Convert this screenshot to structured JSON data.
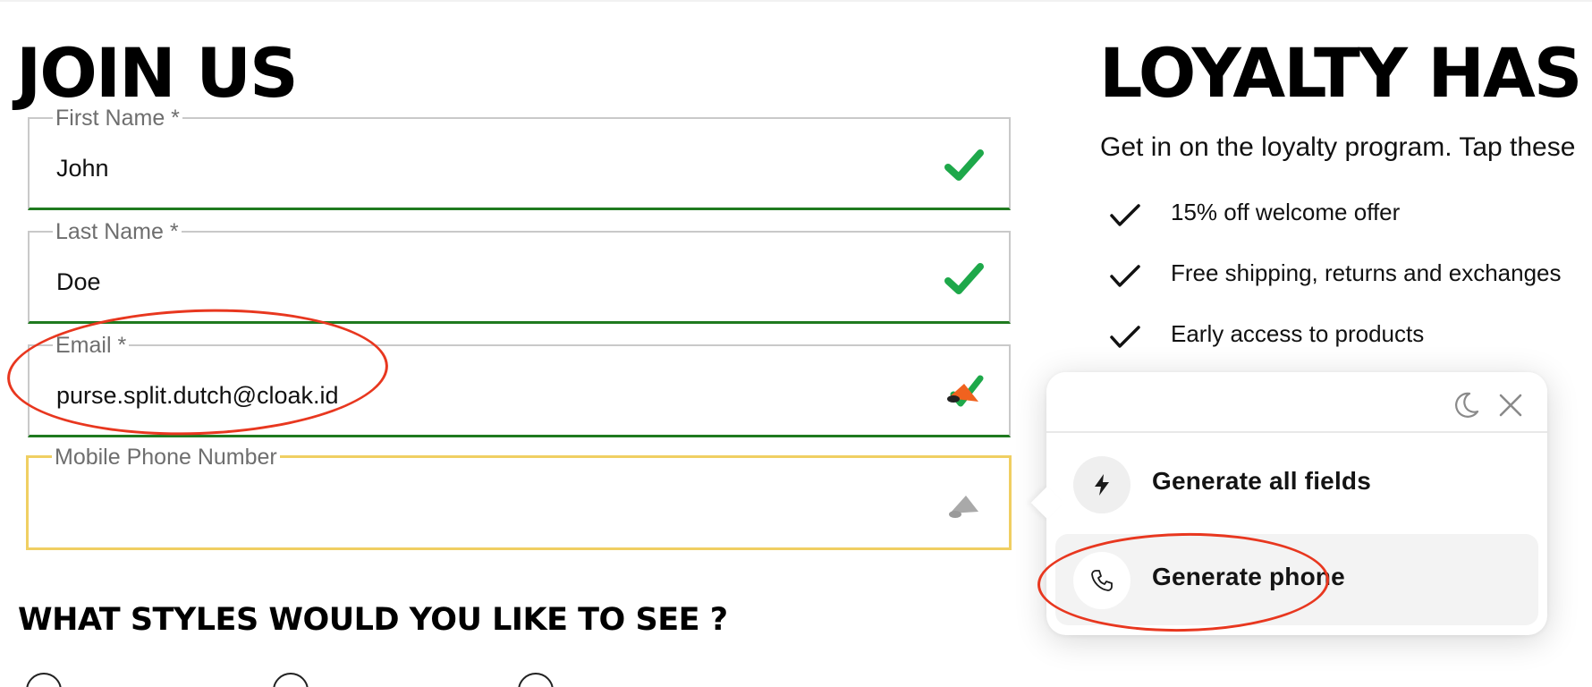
{
  "form": {
    "title": "JOIN US",
    "fields": [
      {
        "label": "First Name *",
        "value": "John",
        "status": "valid"
      },
      {
        "label": "Last Name *",
        "value": "Doe",
        "status": "valid"
      },
      {
        "label": "Email *",
        "value": "purse.split.dutch@cloak.id",
        "status": "valid"
      },
      {
        "label": "Mobile Phone Number",
        "value": "",
        "status": "focused"
      }
    ],
    "styles_title": "WHAT STYLES WOULD YOU LIKE TO SEE ?"
  },
  "loyalty": {
    "title": "LOYALTY HAS",
    "description": "Get in on the loyalty program. Tap these",
    "perks": [
      "15% off welcome offer",
      "Free shipping, returns and exchanges",
      "Early access to products"
    ]
  },
  "popup": {
    "items": [
      {
        "label": "Generate all fields",
        "icon": "lightning-icon"
      },
      {
        "label": "Generate phone",
        "icon": "phone-icon",
        "highlighted": true
      }
    ],
    "header_icons": [
      "moon-icon",
      "close-icon"
    ]
  },
  "colors": {
    "valid_green": "#1ea84a",
    "focus_yellow": "#f0cf62",
    "annotation_red": "#e8371f",
    "cloak_orange": "#f0621f"
  }
}
